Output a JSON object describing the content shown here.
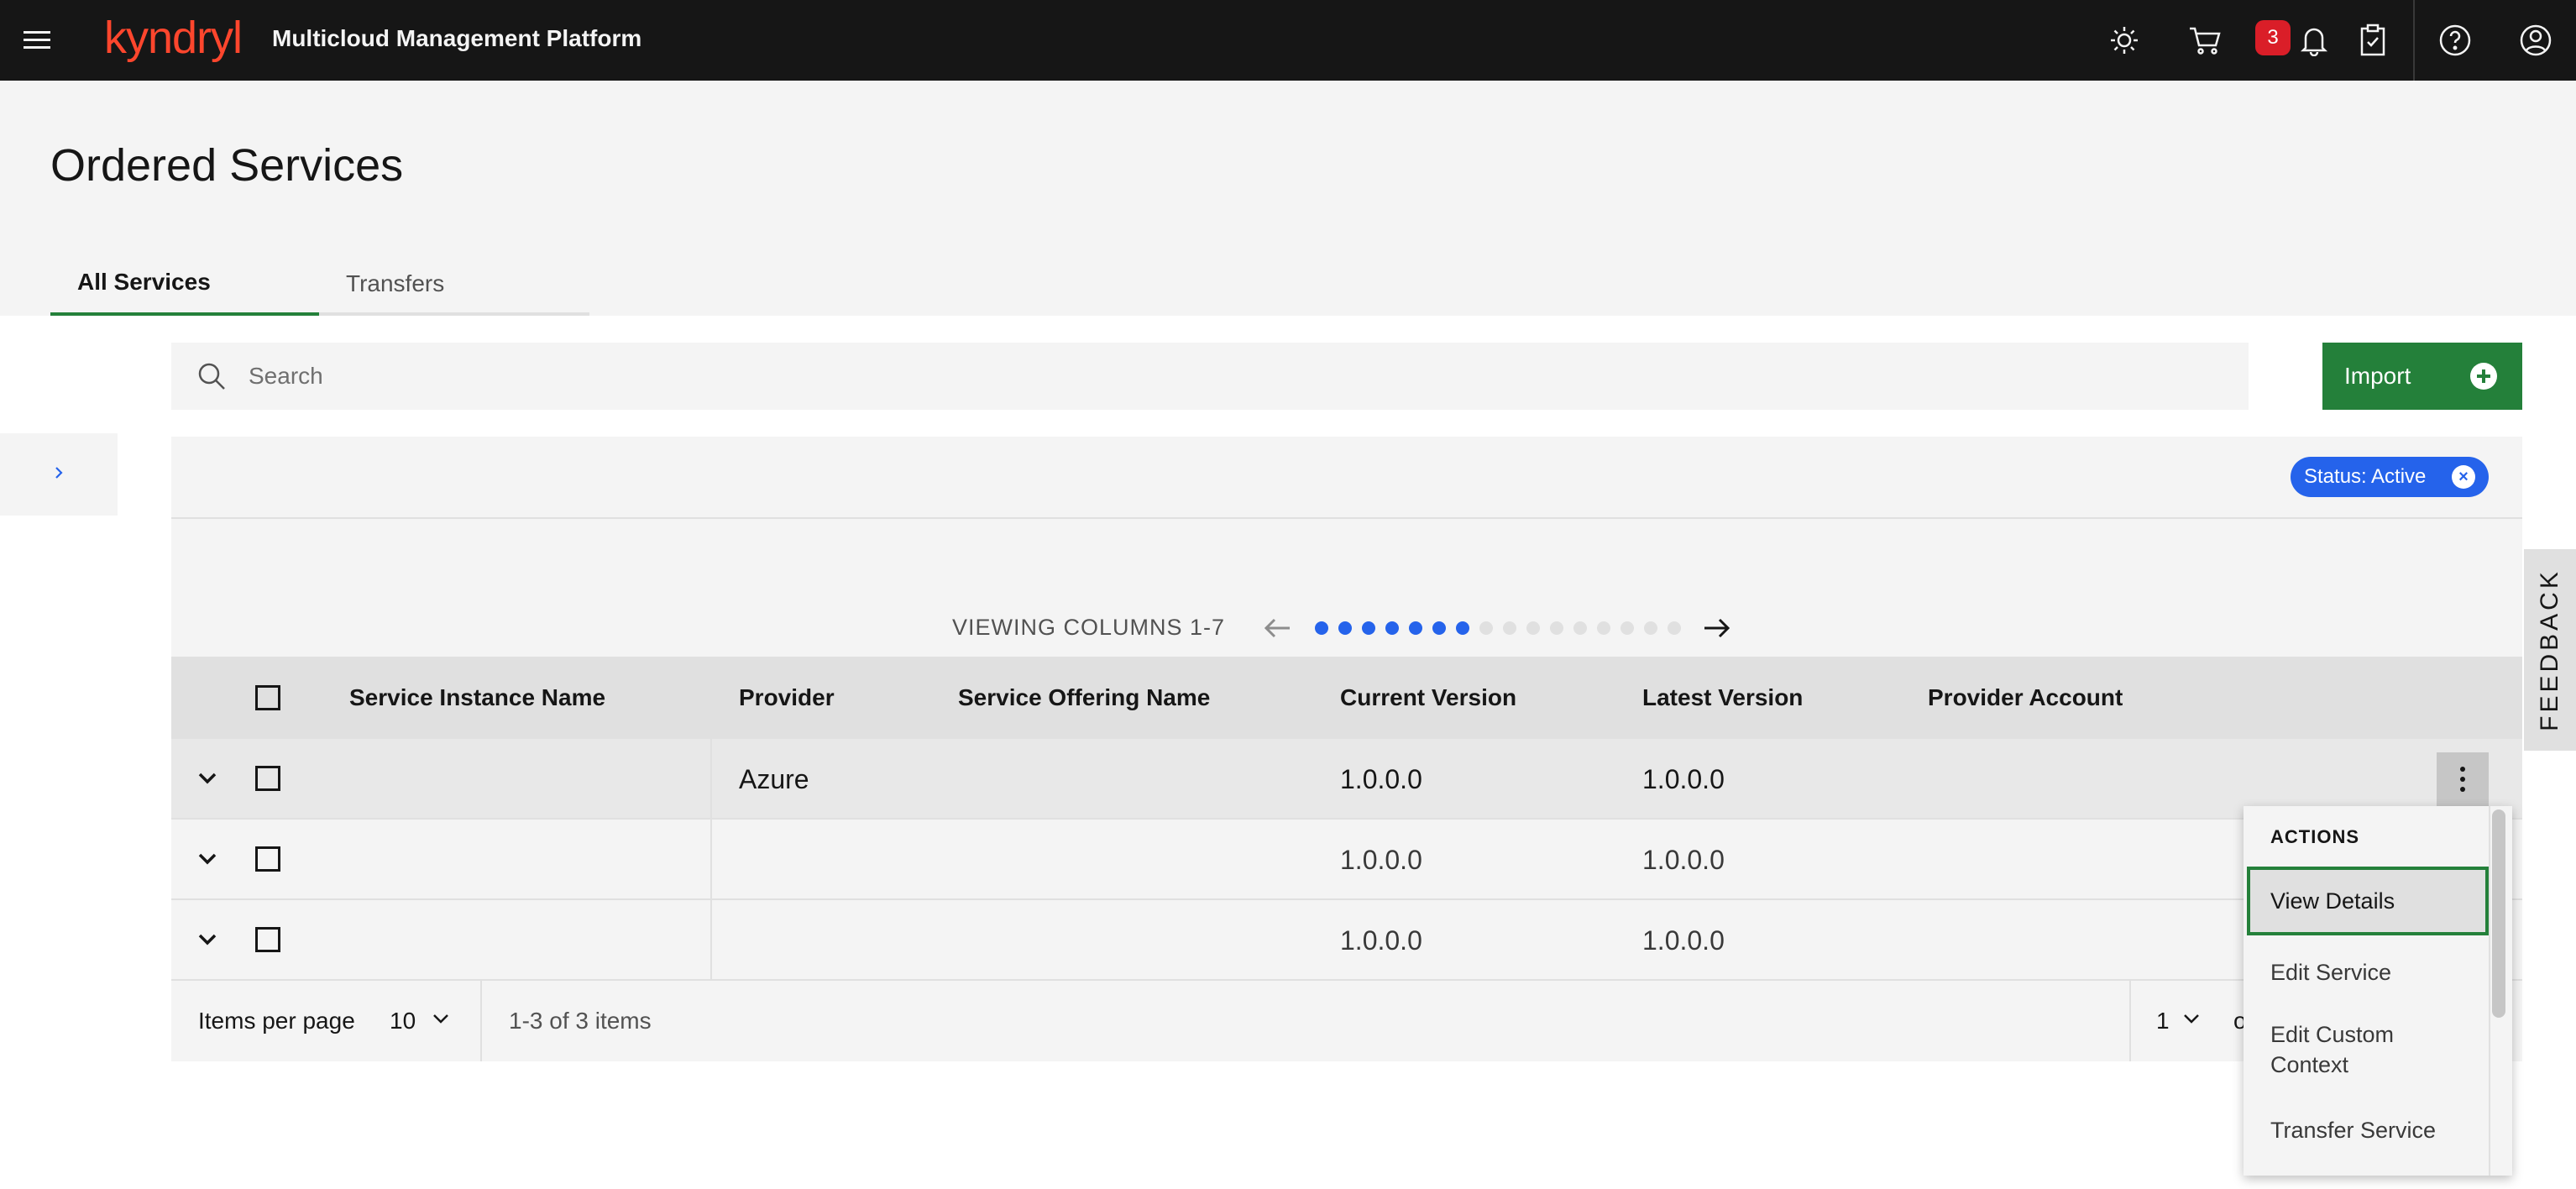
{
  "header": {
    "brand": "kyndryl",
    "product": "Multicloud Management Platform",
    "notification_count": "3"
  },
  "page": {
    "title": "Ordered Services",
    "tabs": [
      {
        "label": "All Services",
        "active": true
      },
      {
        "label": "Transfers",
        "active": false
      }
    ]
  },
  "search": {
    "placeholder": "Search"
  },
  "toolbar": {
    "import_label": "Import"
  },
  "filter": {
    "tag_label": "Status: Active"
  },
  "column_viewer": {
    "label": "VIEWING COLUMNS 1-7",
    "total_dots": 16,
    "active_dots": 7
  },
  "table": {
    "headers": [
      "Service Instance Name",
      "Provider",
      "Service Offering Name",
      "Current Version",
      "Latest Version",
      "Provider Account"
    ],
    "rows": [
      {
        "instance": "",
        "provider": "Azure",
        "offering": "",
        "current": "1.0.0.0",
        "latest": "1.0.0.0",
        "account": ""
      },
      {
        "instance": "",
        "provider": "",
        "offering": "",
        "current": "1.0.0.0",
        "latest": "1.0.0.0",
        "account": ""
      },
      {
        "instance": "",
        "provider": "",
        "offering": "",
        "current": "1.0.0.0",
        "latest": "1.0.0.0",
        "account": ""
      }
    ]
  },
  "pagination": {
    "items_per_page_label": "Items per page",
    "items_per_page_value": "10",
    "range_text": "1-3 of 3 items",
    "page_value": "1",
    "of_text": "o"
  },
  "actions_menu": {
    "title": "ACTIONS",
    "items": [
      "View Details",
      "Edit Service",
      "Edit Custom Context",
      "Transfer Service"
    ]
  },
  "feedback": {
    "label": "FEEDBACK"
  },
  "colors": {
    "brand_red": "#ff462d",
    "accent_green": "#24803a",
    "tag_blue": "#2563eb",
    "badge_red": "#da1e28"
  }
}
